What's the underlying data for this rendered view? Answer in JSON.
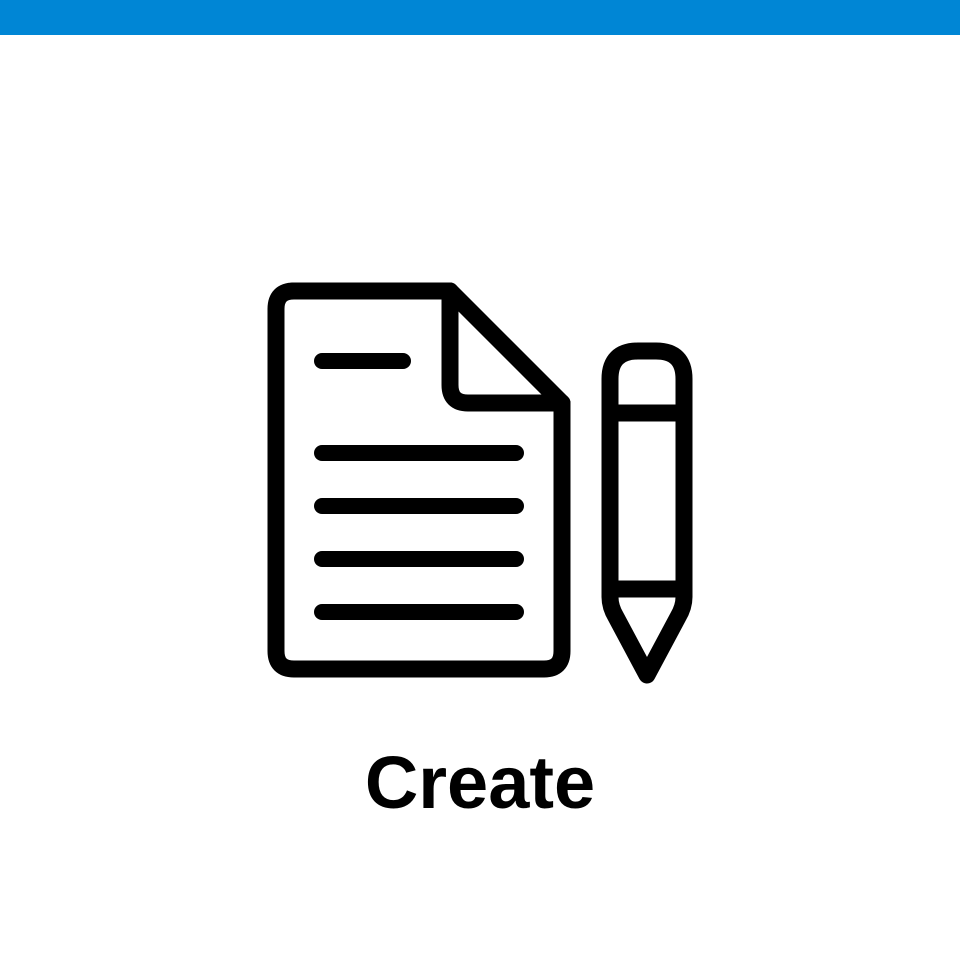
{
  "header": {
    "bar_color": "#0086d5"
  },
  "tile": {
    "label": "Create",
    "icon_primary": "document-icon",
    "icon_secondary": "pencil-icon",
    "text_color": "#000000"
  }
}
